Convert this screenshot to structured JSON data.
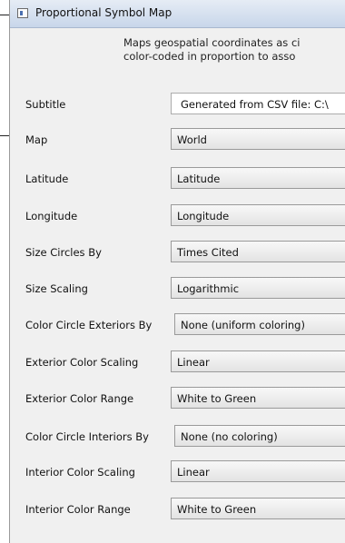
{
  "window": {
    "title": "Proportional Symbol Map",
    "icon": "app-window-icon"
  },
  "description": {
    "line1": "Maps geospatial coordinates as ci",
    "line2": "color-coded in proportion to asso"
  },
  "fields": [
    {
      "label": "Subtitle",
      "value": "Generated from CSV file: C:\\",
      "kind": "text"
    },
    {
      "label": "Map",
      "value": "World",
      "kind": "select"
    },
    {
      "label": "Latitude",
      "value": "Latitude",
      "kind": "select"
    },
    {
      "label": "Longitude",
      "value": "Longitude",
      "kind": "select"
    },
    {
      "label": "Size Circles By",
      "value": "Times Cited",
      "kind": "select"
    },
    {
      "label": "Size Scaling",
      "value": "Logarithmic",
      "kind": "select"
    },
    {
      "label": "Color Circle Exteriors By",
      "value": "None (uniform coloring)",
      "kind": "select"
    },
    {
      "label": "Exterior Color Scaling",
      "value": "Linear",
      "kind": "select"
    },
    {
      "label": "Exterior Color Range",
      "value": "White to Green",
      "kind": "select"
    },
    {
      "label": "Color Circle Interiors By",
      "value": "None (no coloring)",
      "kind": "select"
    },
    {
      "label": "Interior Color Scaling",
      "value": "Linear",
      "kind": "select"
    },
    {
      "label": "Interior Color Range",
      "value": "White to Green",
      "kind": "select"
    }
  ]
}
